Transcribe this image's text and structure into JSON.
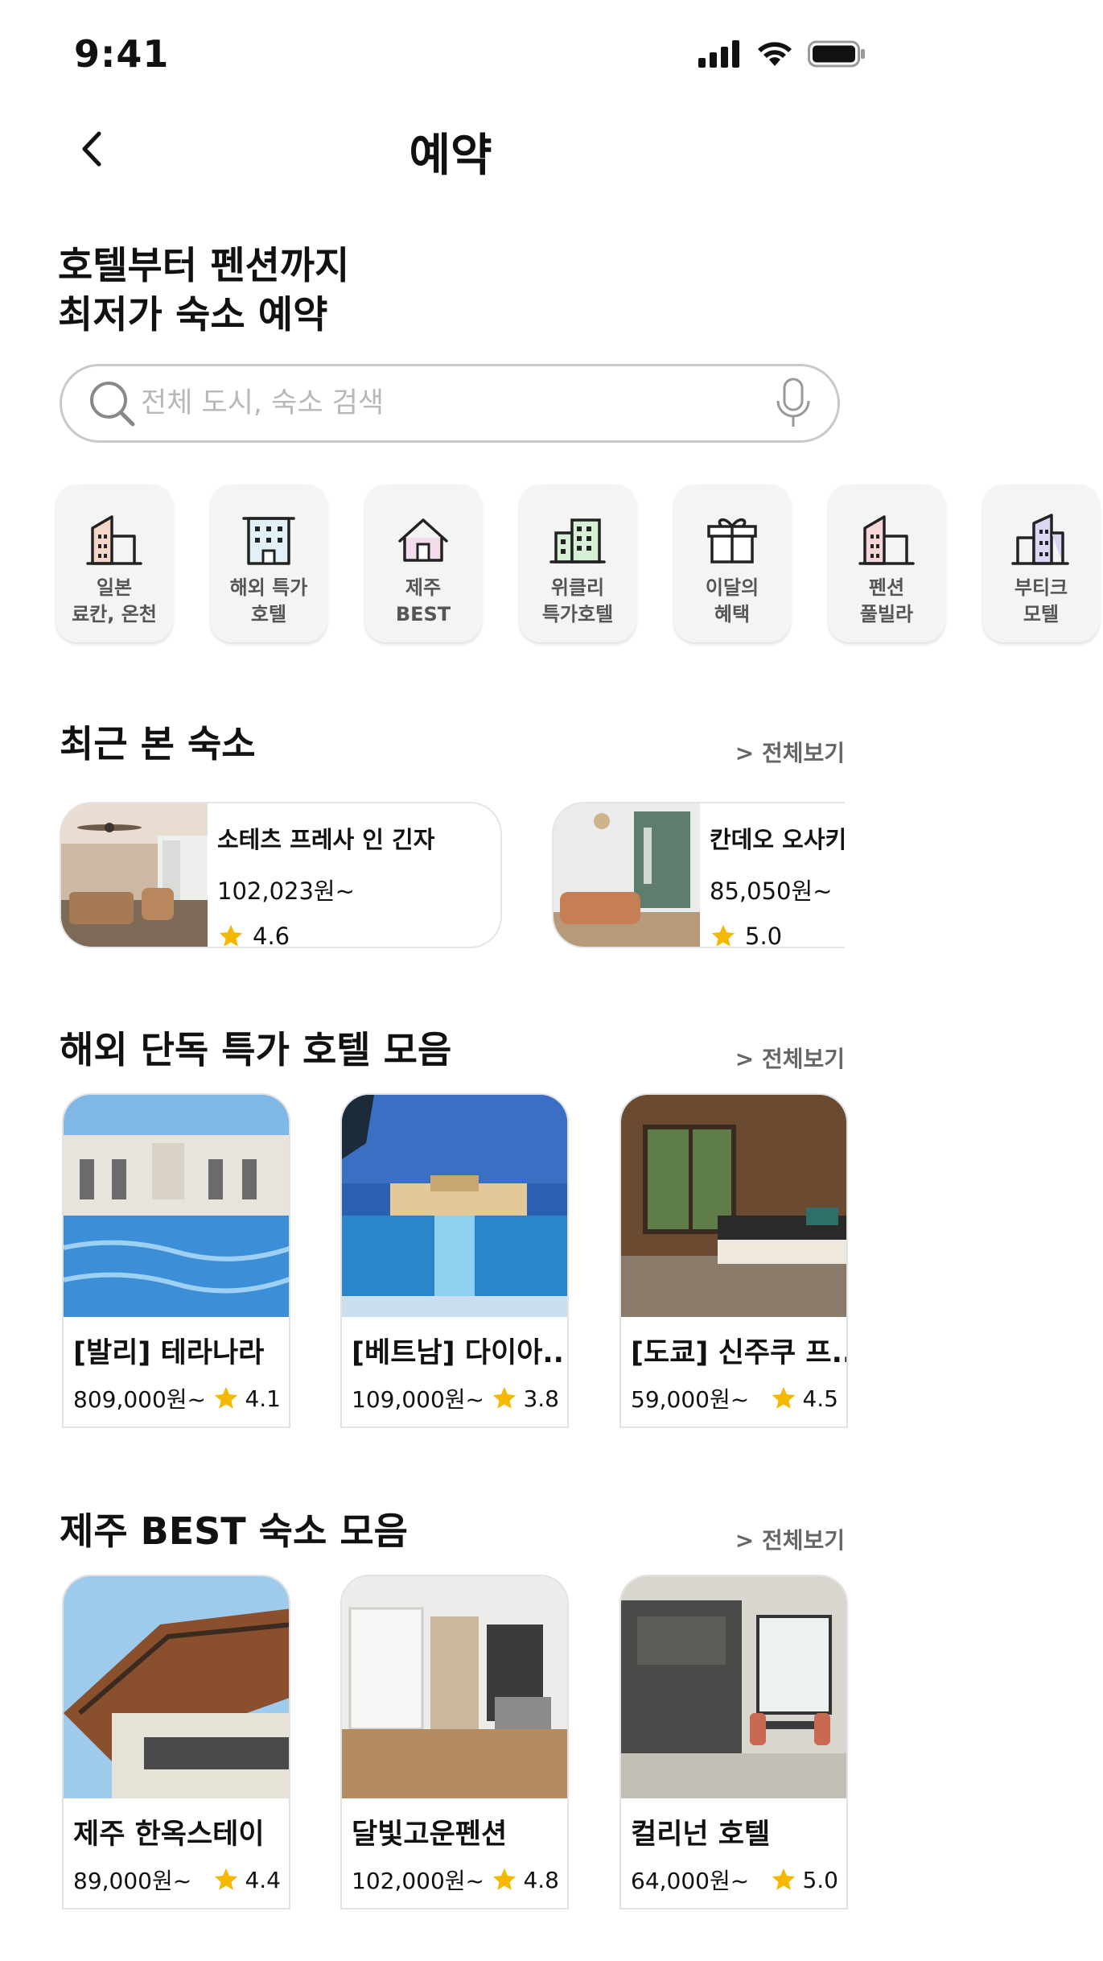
{
  "status_bar": {
    "time": "9:41"
  },
  "header": {
    "title": "예약"
  },
  "hero": {
    "line1": "호텔부터 펜션까지",
    "line2": "최저가 숙소 예약"
  },
  "search": {
    "placeholder": "전체 도시, 숙소 검색",
    "value": ""
  },
  "categories": [
    {
      "label": "일본\n료칸, 온천",
      "icon": "building-icon"
    },
    {
      "label": "해외 특가\n호텔",
      "icon": "hotel-icon"
    },
    {
      "label": "제주\nBEST",
      "icon": "house-icon"
    },
    {
      "label": "위클리\n특가호텔",
      "icon": "office-building-icon"
    },
    {
      "label": "이달의\n혜택",
      "icon": "gift-icon"
    },
    {
      "label": "펜션\n풀빌라",
      "icon": "pension-icon"
    },
    {
      "label": "부티크\n모텔",
      "icon": "boutique-building-icon"
    }
  ],
  "recent": {
    "title": "최근 본 숙소",
    "see_all": "> 전체보기",
    "items": [
      {
        "name": "소테츠 프레사 인 긴자",
        "price": "102,023원~",
        "rating": "4.6"
      },
      {
        "name": "칸데오 오사키",
        "price": "85,050원~",
        "rating": "5.0"
      }
    ]
  },
  "overseas": {
    "title": "해외 단독 특가 호텔 모음",
    "see_all": "> 전체보기",
    "items": [
      {
        "name": "[발리] 테라나라",
        "price": "809,000원~",
        "rating": "4.1"
      },
      {
        "name": "[베트남] 다이아..",
        "price": "109,000원~",
        "rating": "3.8"
      },
      {
        "name": "[도쿄] 신주쿠 프..",
        "price": "59,000원~",
        "rating": "4.5"
      }
    ]
  },
  "jeju": {
    "title": "제주 BEST 숙소 모음",
    "see_all": "> 전체보기",
    "items": [
      {
        "name": "제주 한옥스테이",
        "price": "89,000원~",
        "rating": "4.4"
      },
      {
        "name": "달빛고운펜션",
        "price": "102,000원~",
        "rating": "4.8"
      },
      {
        "name": "컬리넌 호텔",
        "price": "64,000원~",
        "rating": "5.0"
      }
    ]
  },
  "colors": {
    "star": "#F5B800",
    "border": "#E2E2E2",
    "accent": "#111111"
  }
}
